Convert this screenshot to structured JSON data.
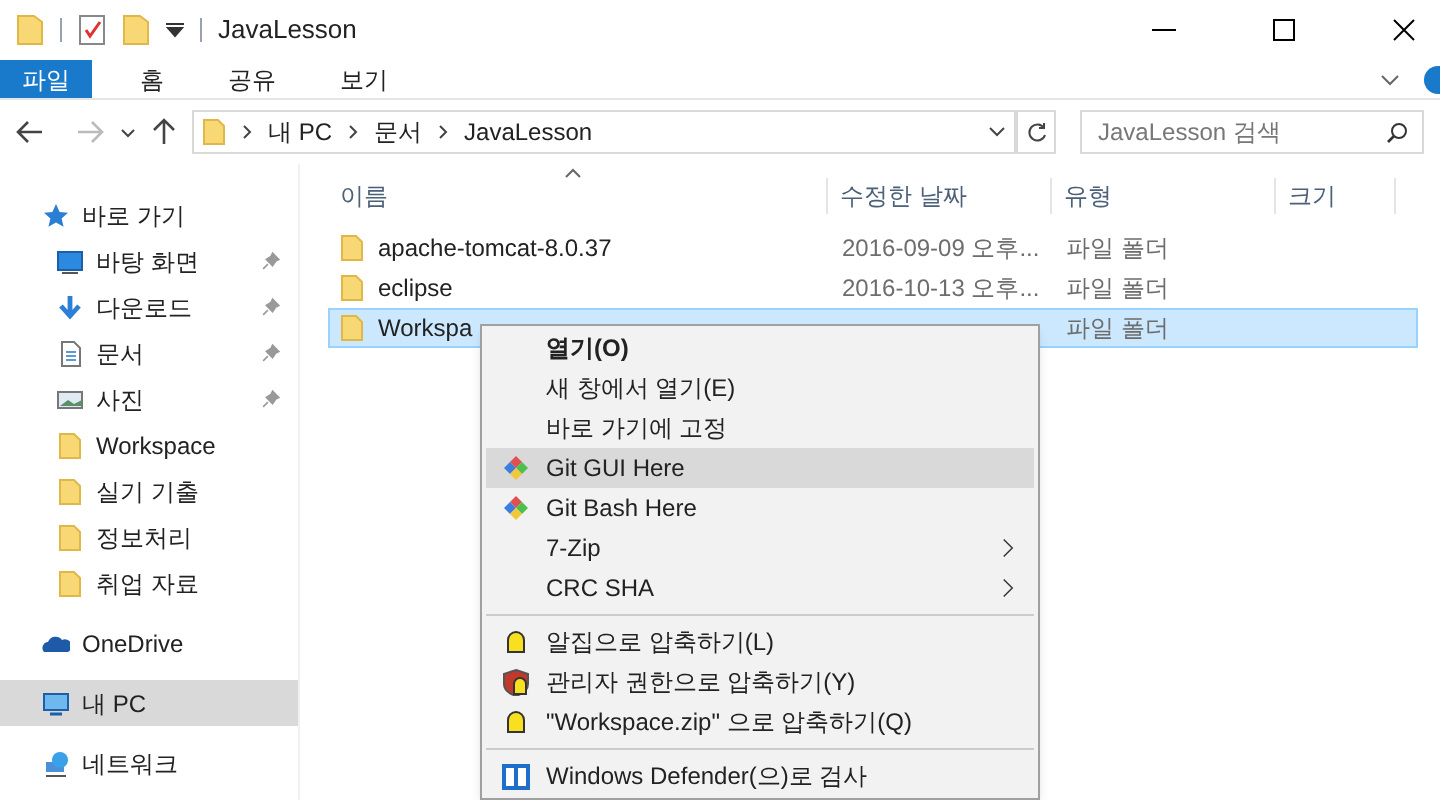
{
  "window": {
    "title": "JavaLesson"
  },
  "ribbon_tabs": [
    {
      "label": "파일",
      "selected": true
    },
    {
      "label": "홈",
      "selected": false
    },
    {
      "label": "공유",
      "selected": false
    },
    {
      "label": "보기",
      "selected": false
    }
  ],
  "address_bar": {
    "segments": [
      "내 PC",
      "문서",
      "JavaLesson"
    ]
  },
  "search": {
    "placeholder": "JavaLesson 검색"
  },
  "sidebar": {
    "items": [
      {
        "label": "바로 가기",
        "pinned": false,
        "selected": false
      },
      {
        "label": "바탕 화면",
        "pinned": true,
        "selected": false
      },
      {
        "label": "다운로드",
        "pinned": true,
        "selected": false
      },
      {
        "label": "문서",
        "pinned": true,
        "selected": false
      },
      {
        "label": "사진",
        "pinned": true,
        "selected": false
      },
      {
        "label": "Workspace",
        "pinned": false,
        "selected": false
      },
      {
        "label": "실기 기출",
        "pinned": false,
        "selected": false
      },
      {
        "label": "정보처리",
        "pinned": false,
        "selected": false
      },
      {
        "label": "취업 자료",
        "pinned": false,
        "selected": false
      },
      {
        "label": "OneDrive",
        "pinned": false,
        "selected": false
      },
      {
        "label": "내 PC",
        "pinned": false,
        "selected": true
      },
      {
        "label": "네트워크",
        "pinned": false,
        "selected": false
      }
    ]
  },
  "table": {
    "columns": [
      "이름",
      "수정한 날짜",
      "유형",
      "크기"
    ],
    "rows": [
      {
        "name": "apache-tomcat-8.0.37",
        "modified": "2016-09-09 오후...",
        "type": "파일 폴더",
        "selected": false
      },
      {
        "name": "eclipse",
        "modified": "2016-10-13 오후...",
        "type": "파일 폴더",
        "selected": false
      },
      {
        "name": "Workspa",
        "type": "파일 폴더",
        "selected": true
      }
    ]
  },
  "context_menu": {
    "items": [
      {
        "kind": "item",
        "label": "열기(O)",
        "bold": true,
        "selected": false,
        "submenu": false
      },
      {
        "kind": "item",
        "label": "새 창에서 열기(E)",
        "bold": false,
        "selected": false,
        "submenu": false
      },
      {
        "kind": "item",
        "label": "바로 가기에 고정",
        "bold": false,
        "selected": false,
        "submenu": false
      },
      {
        "kind": "item",
        "label": "Git GUI Here",
        "bold": false,
        "selected": true,
        "submenu": false
      },
      {
        "kind": "item",
        "label": "Git Bash Here",
        "bold": false,
        "selected": false,
        "submenu": false
      },
      {
        "kind": "item",
        "label": "7-Zip",
        "bold": false,
        "selected": false,
        "submenu": true
      },
      {
        "kind": "item",
        "label": "CRC SHA",
        "bold": false,
        "selected": false,
        "submenu": true
      },
      {
        "kind": "separator"
      },
      {
        "kind": "item",
        "label": "알집으로 압축하기(L)",
        "bold": false,
        "selected": false,
        "submenu": false
      },
      {
        "kind": "item",
        "label": "관리자 권한으로 압축하기(Y)",
        "bold": false,
        "selected": false,
        "submenu": false
      },
      {
        "kind": "item",
        "label": "\"Workspace.zip\" 으로 압축하기(Q)",
        "bold": false,
        "selected": false,
        "submenu": false
      },
      {
        "kind": "separator"
      },
      {
        "kind": "item",
        "label": "Windows Defender(으)로 검사",
        "bold": false,
        "selected": false,
        "submenu": false
      }
    ]
  }
}
